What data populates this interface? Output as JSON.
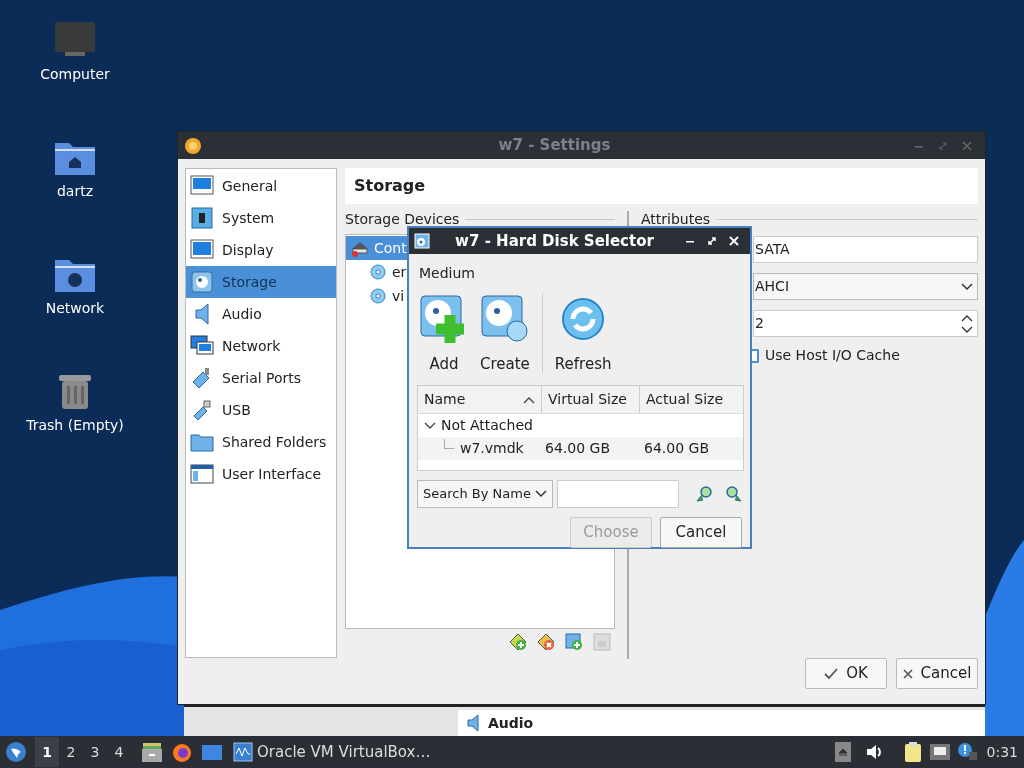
{
  "desktop": {
    "icons": [
      {
        "label": "Computer",
        "kind": "computer"
      },
      {
        "label": "dartz",
        "kind": "home"
      },
      {
        "label": "Network",
        "kind": "network"
      },
      {
        "label": "Trash (Empty)",
        "kind": "trash"
      }
    ]
  },
  "settings_window": {
    "title": "w7 - Settings",
    "sidebar": {
      "items": [
        {
          "label": "General",
          "kind": "general",
          "selected": false
        },
        {
          "label": "System",
          "kind": "system",
          "selected": false
        },
        {
          "label": "Display",
          "kind": "display",
          "selected": false
        },
        {
          "label": "Storage",
          "kind": "storage",
          "selected": true
        },
        {
          "label": "Audio",
          "kind": "audio",
          "selected": false
        },
        {
          "label": "Network",
          "kind": "network",
          "selected": false
        },
        {
          "label": "Serial Ports",
          "kind": "serial",
          "selected": false
        },
        {
          "label": "USB",
          "kind": "usb",
          "selected": false
        },
        {
          "label": "Shared Folders",
          "kind": "folder",
          "selected": false
        },
        {
          "label": "User Interface",
          "kind": "ui",
          "selected": false
        }
      ]
    },
    "page_title": "Storage",
    "storage_devices": {
      "label": "Storage Devices",
      "tree": [
        {
          "label": "Cont",
          "kind": "controller",
          "selected": true,
          "children": [
            {
              "label": "er",
              "kind": "disc",
              "selected": false
            },
            {
              "label": "vi",
              "kind": "disc",
              "selected": false
            }
          ]
        }
      ]
    },
    "attributes": {
      "label": "Attributes",
      "name": "SATA",
      "type": "AHCI",
      "port_count": "2",
      "host_io_cache": {
        "label": "Use Host I/O Cache",
        "checked": false
      }
    },
    "buttons": [
      {
        "label": "OK",
        "kind": "ok"
      },
      {
        "label": "Cancel",
        "kind": "cancel"
      }
    ]
  },
  "background_window": {
    "page_title": "Audio"
  },
  "hard_disk_selector": {
    "title": "w7 - Hard Disk Selector",
    "section_label": "Medium",
    "toolbar": [
      {
        "label": "Add",
        "kind": "add"
      },
      {
        "label": "Create",
        "kind": "create"
      },
      {
        "label": "Refresh",
        "kind": "refresh"
      }
    ],
    "table": {
      "columns": [
        "Name",
        "Virtual Size",
        "Actual Size"
      ],
      "rows": [
        {
          "name": "Not Attached",
          "expanded": true,
          "children": [
            {
              "name": "w7.vmdk",
              "virtual_size": "64.00 GB",
              "actual_size": "64.00 GB"
            }
          ]
        }
      ]
    },
    "search": {
      "mode": "Search By Name"
    },
    "buttons": [
      {
        "label": "Choose",
        "disabled": true
      },
      {
        "label": "Cancel",
        "disabled": false
      }
    ]
  },
  "taskbar": {
    "workspaces": [
      {
        "label": "1",
        "selected": true
      },
      {
        "label": "2",
        "selected": false
      },
      {
        "label": "3",
        "selected": false
      },
      {
        "label": "4",
        "selected": false
      }
    ],
    "tasks": [
      {
        "label": "Oracle VM VirtualBox…"
      }
    ],
    "clock": "0:31"
  }
}
